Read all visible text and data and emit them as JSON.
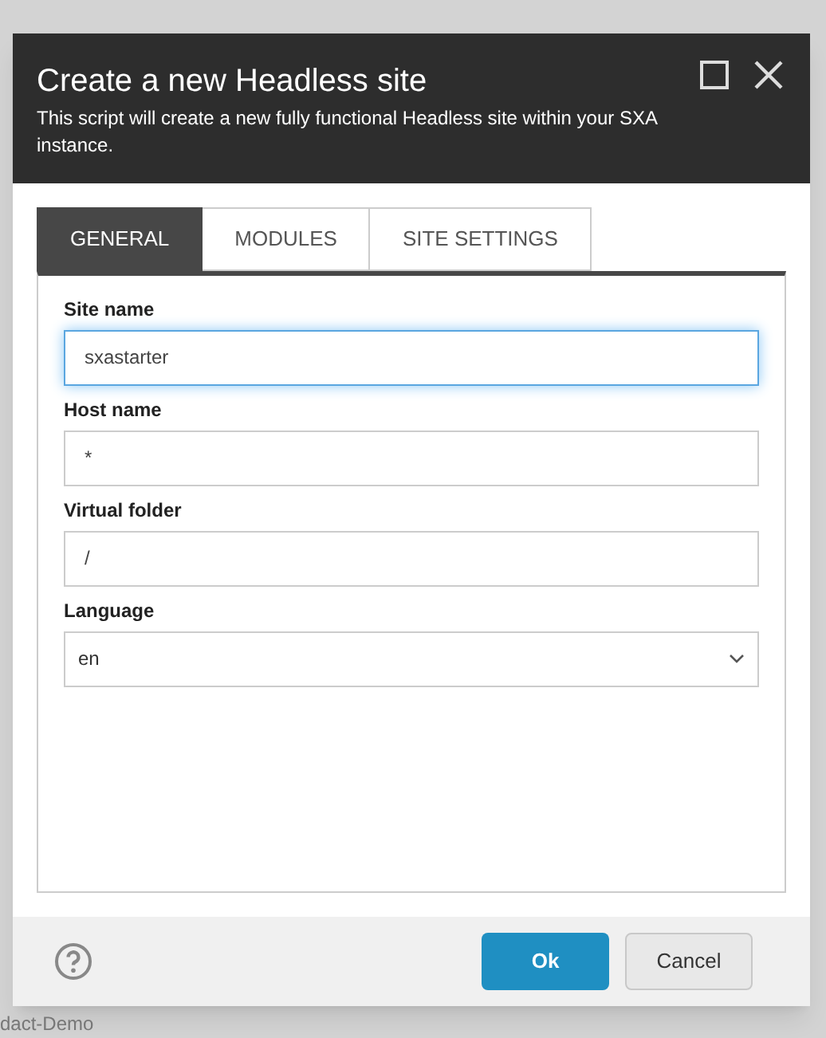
{
  "background": {
    "footer_text": "dact-Demo"
  },
  "dialog": {
    "title": "Create a new Headless site",
    "subtitle": "This script will create a new fully functional Headless site within your SXA instance.",
    "tabs": [
      {
        "label": "GENERAL",
        "selected": true
      },
      {
        "label": "MODULES",
        "selected": false
      },
      {
        "label": "SITE SETTINGS",
        "selected": false
      }
    ],
    "fields": [
      {
        "label": "Site name",
        "value": "sxastarter",
        "kind": "text",
        "focused": true
      },
      {
        "label": "Host name",
        "value": "*",
        "kind": "text",
        "focused": false
      },
      {
        "label": "Virtual folder",
        "value": "/",
        "kind": "text",
        "focused": false
      },
      {
        "label": "Language",
        "value": "en",
        "kind": "select",
        "focused": false
      }
    ],
    "buttons": [
      {
        "label": "Ok",
        "kind": "primary"
      },
      {
        "label": "Cancel",
        "kind": "secondary"
      }
    ]
  }
}
